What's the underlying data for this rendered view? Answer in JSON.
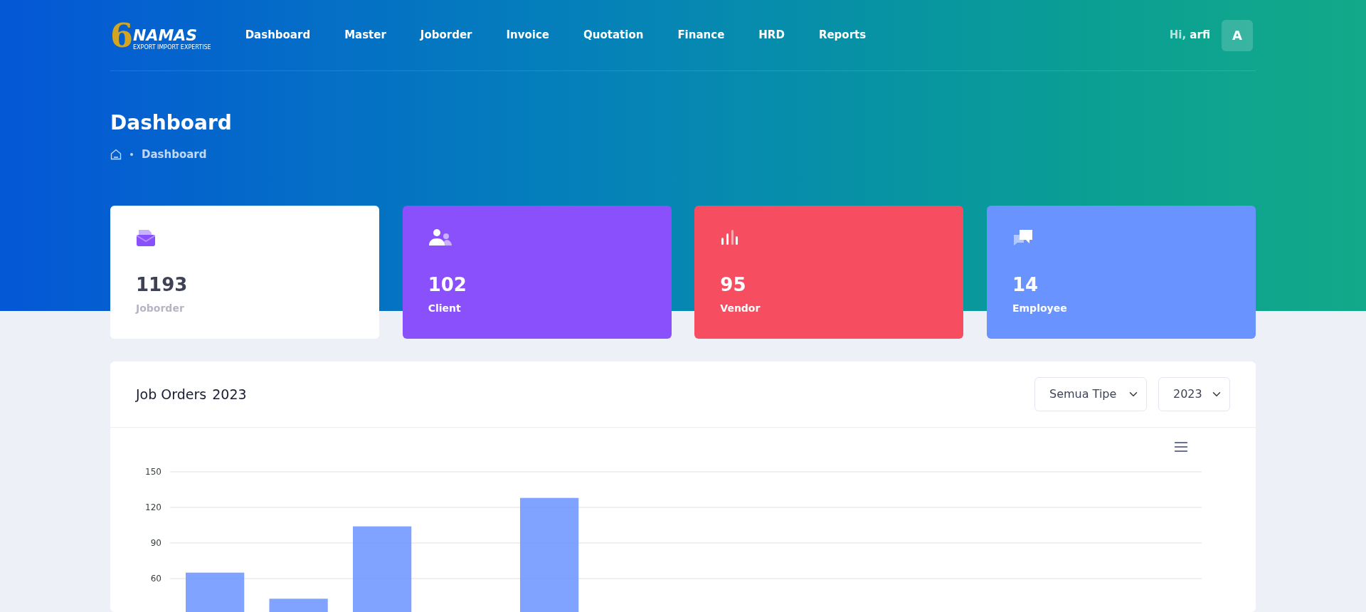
{
  "header": {
    "logo": {
      "mark": "6",
      "name": "NAMAS",
      "tagline": "EXPORT IMPORT EXPERTISE"
    },
    "nav": [
      {
        "label": "Dashboard"
      },
      {
        "label": "Master"
      },
      {
        "label": "Joborder"
      },
      {
        "label": "Invoice"
      },
      {
        "label": "Quotation"
      },
      {
        "label": "Finance"
      },
      {
        "label": "HRD"
      },
      {
        "label": "Reports"
      }
    ],
    "greeting": "Hi,",
    "user": "arfi",
    "avatar": "A"
  },
  "page": {
    "title": "Dashboard",
    "breadcrumb": [
      "Dashboard"
    ]
  },
  "stats": [
    {
      "value": "1193",
      "label": "Joborder",
      "kind": "light",
      "color": "#ffffff"
    },
    {
      "value": "102",
      "label": "Client",
      "kind": "solid",
      "color": "#8950fc"
    },
    {
      "value": "95",
      "label": "Vendor",
      "kind": "solid",
      "color": "#f64e60"
    },
    {
      "value": "14",
      "label": "Employee",
      "kind": "solid",
      "color": "#6993ff"
    }
  ],
  "job_orders": {
    "title": "Job Orders",
    "year": "2023",
    "type_filter": "Semua Tipe",
    "year_filter": "2023",
    "chart_data": {
      "type": "bar",
      "grid": true,
      "ylim": [
        0,
        150
      ],
      "yticks": [
        60,
        90,
        120,
        150
      ],
      "series": [
        {
          "color": "#6993ff",
          "values": [
            65,
            43,
            104,
            null,
            128,
            null,
            null,
            null,
            null,
            null,
            null,
            null
          ]
        }
      ]
    }
  }
}
